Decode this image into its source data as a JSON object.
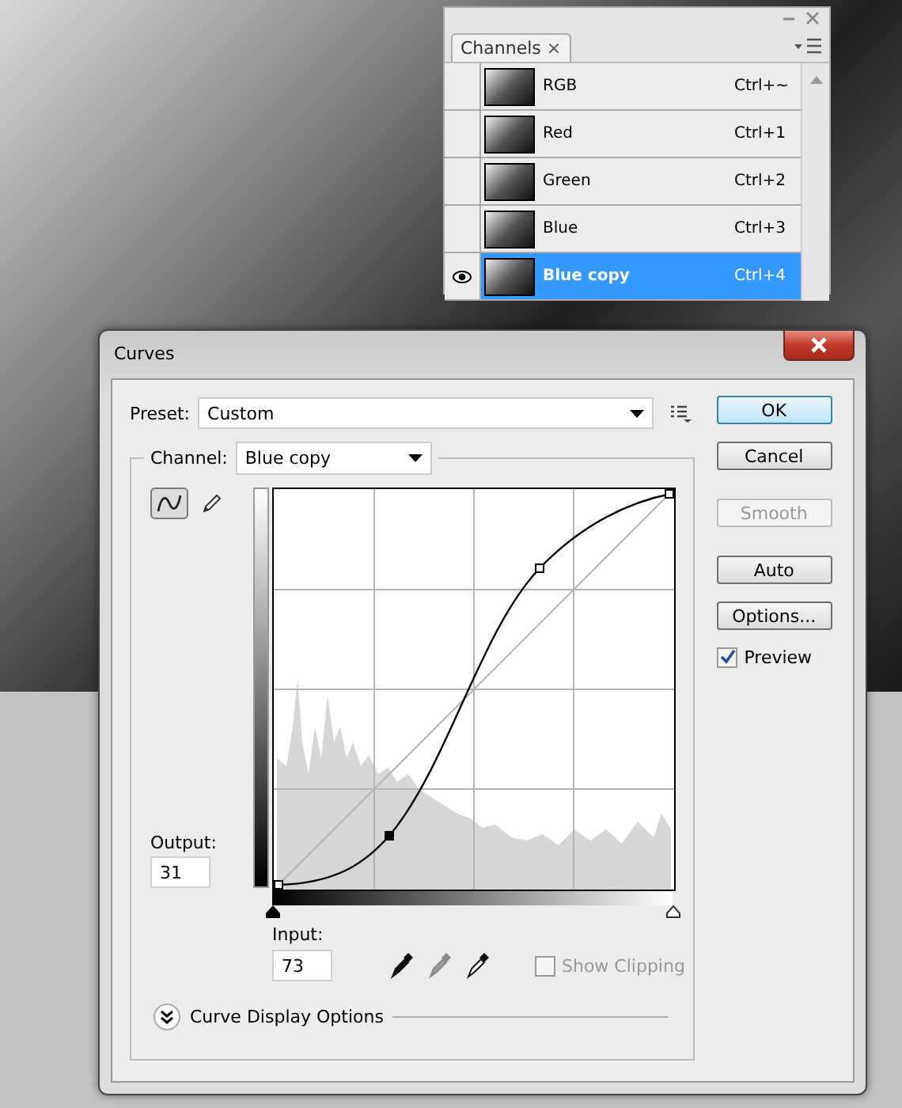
{
  "channels_panel": {
    "tab": {
      "label": "Channels",
      "close": "×"
    },
    "channels": [
      {
        "name": "RGB",
        "shortcut": "Ctrl+~",
        "visible": false,
        "selected": false
      },
      {
        "name": "Red",
        "shortcut": "Ctrl+1",
        "visible": false,
        "selected": false
      },
      {
        "name": "Green",
        "shortcut": "Ctrl+2",
        "visible": false,
        "selected": false
      },
      {
        "name": "Blue",
        "shortcut": "Ctrl+3",
        "visible": false,
        "selected": false
      },
      {
        "name": "Blue copy",
        "shortcut": "Ctrl+4",
        "visible": true,
        "selected": true
      }
    ]
  },
  "curves_dialog": {
    "title": "Curves",
    "preset": {
      "label": "Preset:",
      "value": "Custom"
    },
    "channel": {
      "label": "Channel:",
      "value": "Blue copy"
    },
    "tools": [
      {
        "kind": "curve",
        "selected": true
      },
      {
        "kind": "pencil",
        "selected": false
      }
    ],
    "output": {
      "label": "Output:",
      "value": "31"
    },
    "input": {
      "label": "Input:",
      "value": "73"
    },
    "eyedroppers": [
      {
        "kind": "black"
      },
      {
        "kind": "gray"
      },
      {
        "kind": "white"
      }
    ],
    "show_clipping": {
      "label": "Show Clipping",
      "checked": false,
      "disabled": true
    },
    "curve_display_options": {
      "label": "Curve Display Options",
      "expanded": false
    },
    "buttons": [
      {
        "label": "OK",
        "default": true,
        "disabled": false
      },
      {
        "label": "Cancel",
        "default": false,
        "disabled": false
      },
      {
        "label": "Smooth",
        "default": false,
        "disabled": true
      },
      {
        "label": "Auto",
        "default": false,
        "disabled": false
      },
      {
        "label": "Options...",
        "default": false,
        "disabled": false
      }
    ],
    "preview": {
      "label": "Preview",
      "checked": true
    }
  }
}
